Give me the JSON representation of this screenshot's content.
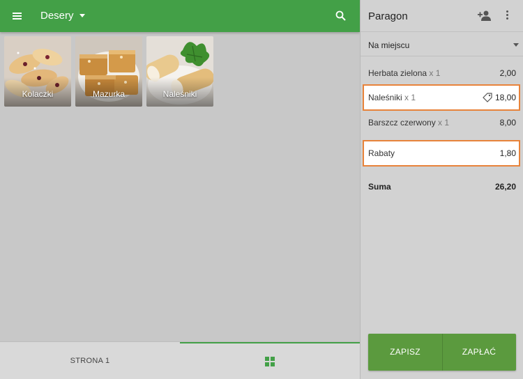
{
  "appbar": {
    "category": "Desery"
  },
  "products": [
    {
      "label": "Kolaczki"
    },
    {
      "label": "Mazurka"
    },
    {
      "label": "Naleśniki"
    }
  ],
  "bottom": {
    "page_label": "STRONA 1"
  },
  "receipt": {
    "title": "Paragon",
    "order_type": "Na miejscu",
    "items": [
      {
        "name": "Herbata zielona",
        "qty": "x 1",
        "price": "2,00"
      },
      {
        "name": "Naleśniki",
        "qty": "x 1",
        "price": "18,00"
      },
      {
        "name": "Barszcz czerwony",
        "qty": "x 1",
        "price": "8,00"
      }
    ],
    "discount": {
      "label": "Rabaty",
      "amount": "1,80"
    },
    "sum": {
      "label": "Suma",
      "amount": "26,20"
    },
    "buttons": {
      "save": "ZAPISZ",
      "pay": "ZAPŁAĆ"
    }
  },
  "colors": {
    "primary": "#43a047",
    "highlight": "#e8833a",
    "action": "#5b9a3e"
  },
  "icons": [
    "menu-icon",
    "dropdown-caret-icon",
    "search-icon",
    "add-person-icon",
    "more-vert-icon",
    "tag-icon",
    "grid-icon"
  ]
}
